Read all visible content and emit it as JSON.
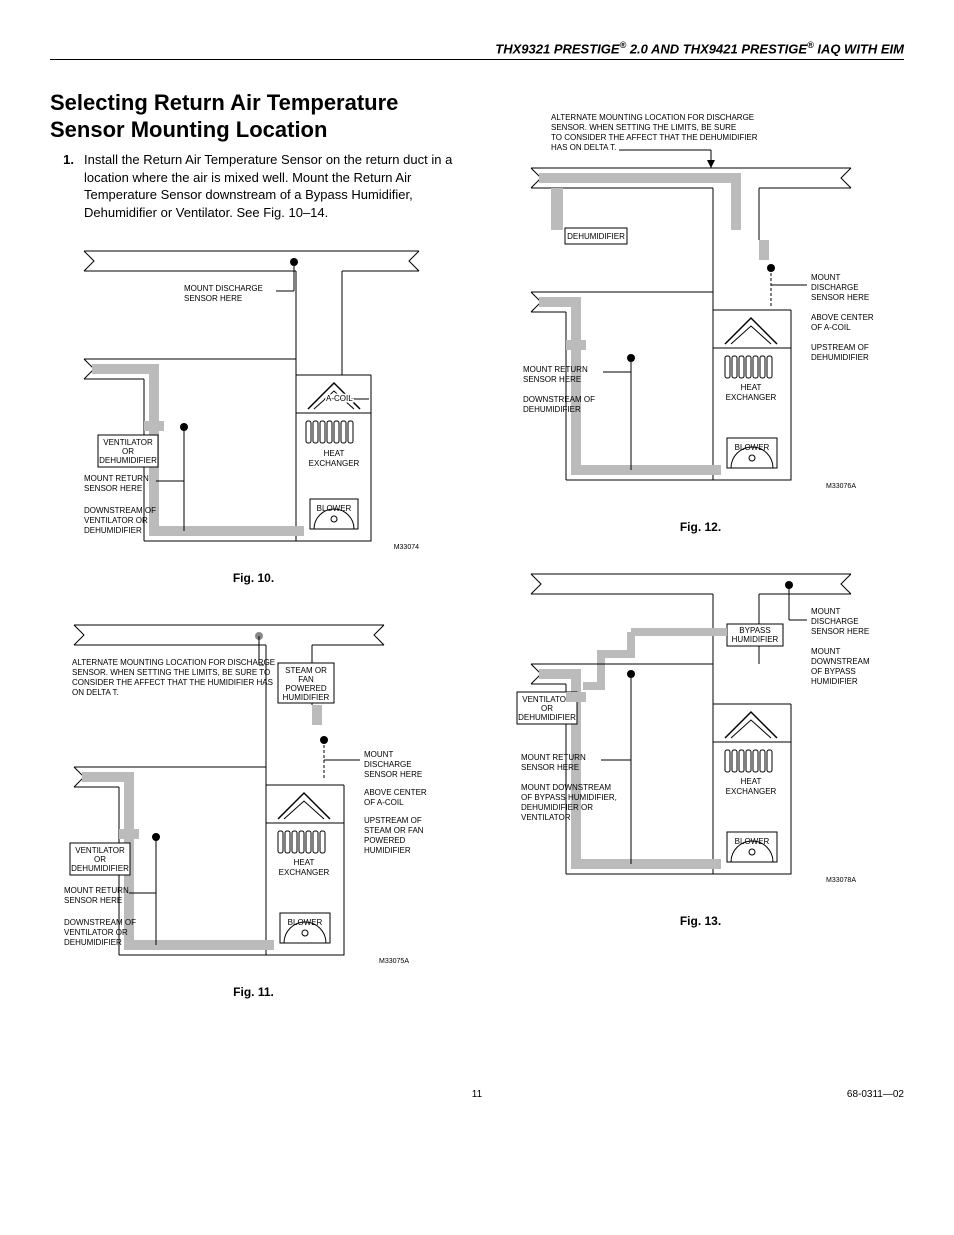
{
  "header": {
    "left": "THX9321 PRESTIGE",
    "reg": "®",
    "mid": " 2.0 AND THX9421 PRESTIGE",
    "right": " IAQ WITH EIM"
  },
  "section_title": "Selecting Return Air Temperature Sensor Mounting Location",
  "list": {
    "num1": "1.",
    "txt1": "Install the Return Air Temperature Sensor on the return duct in a location where the air is mixed well. Mount the Return Air Temperature Sensor downstream of a Bypass Humidifier, Dehumidifier or Ventilator. See Fig. 10–14."
  },
  "fig10": {
    "caption": "Fig. 10.",
    "mount_discharge1": "MOUNT DISCHARGE",
    "mount_discharge2": "SENSOR HERE",
    "acoil": "A-COIL",
    "heat_ex1": "HEAT",
    "heat_ex2": "EXCHANGER",
    "blower": "BLOWER",
    "vent1": "VENTILATOR",
    "vent2": "OR",
    "vent3": "DEHUMIDIFIER",
    "mr1": "MOUNT RETURN",
    "mr2": "SENSOR HERE",
    "ds1": "DOWNSTREAM OF",
    "ds2": "VENTILATOR OR",
    "ds3": "DEHUMIDIFIER",
    "code": "M33074"
  },
  "fig11": {
    "caption": "Fig. 11.",
    "alt1": "ALTERNATE  MOUNTING LOCATION FOR DISCHARGE",
    "alt2": "SENSOR. WHEN SETTING THE LIMITS, BE SURE TO",
    "alt3": "CONSIDER THE AFFECT THAT THE HUMIDIFIER HAS",
    "alt4": "ON DELTA T.",
    "steam1": "STEAM OR",
    "steam2": "FAN",
    "steam3": "POWERED",
    "steam4": "HUMIDIFIER",
    "md1": "MOUNT",
    "md2": "DISCHARGE",
    "md3": "SENSOR HERE",
    "ac1": "ABOVE CENTER",
    "ac2": "OF A-COIL",
    "up1": "UPSTREAM OF",
    "up2": "STEAM OR FAN",
    "up3": "POWERED",
    "up4": "HUMIDIFIER",
    "heat_ex1": "HEAT",
    "heat_ex2": "EXCHANGER",
    "blower": "BLOWER",
    "vent1": "VENTILATOR",
    "vent2": "OR",
    "vent3": "DEHUMIDIFIER",
    "mr1": "MOUNT RETURN",
    "mr2": "SENSOR HERE",
    "ds1": "DOWNSTREAM OF",
    "ds2": "VENTILATOR OR",
    "ds3": "DEHUMIDIFIER",
    "code": "M33075A"
  },
  "fig12": {
    "caption": "Fig. 12.",
    "alt1": "ALTERNATE MOUNTING LOCATION FOR DISCHARGE",
    "alt2": "SENSOR. WHEN SETTING THE LIMITS, BE SURE",
    "alt3": "TO CONSIDER THE AFFECT THAT THE DEHUMIDIFIER",
    "alt4": "HAS ON DELTA T.",
    "dehum": "DEHUMIDIFIER",
    "md1": "MOUNT",
    "md2": "DISCHARGE",
    "md3": "SENSOR HERE",
    "ac1": "ABOVE CENTER",
    "ac2": "OF A-COIL",
    "up1": "UPSTREAM OF",
    "up2": "DEHUMIDIFIER",
    "heat_ex1": "HEAT",
    "heat_ex2": "EXCHANGER",
    "blower": "BLOWER",
    "mr1": "MOUNT RETURN",
    "mr2": "SENSOR HERE",
    "ds1": "DOWNSTREAM OF",
    "ds2": "DEHUMIDIFIER",
    "code": "M33076A"
  },
  "fig13": {
    "caption": "Fig. 13.",
    "bypass1": "BYPASS",
    "bypass2": "HUMIDIFIER",
    "md1": "MOUNT",
    "md2": "DISCHARGE",
    "md3": "SENSOR HERE",
    "mdn1": "MOUNT",
    "mdn2": "DOWNSTREAM",
    "mdn3": "OF BYPASS",
    "mdn4": "HUMIDIFIER",
    "vent1": "VENTILATOR",
    "vent2": "OR",
    "vent3": "DEHUMIDIFIER",
    "heat_ex1": "HEAT",
    "heat_ex2": "EXCHANGER",
    "blower": "BLOWER",
    "mr1": "MOUNT RETURN",
    "mr2": "SENSOR HERE",
    "ds1": "MOUNT DOWNSTREAM",
    "ds2": "OF BYPASS HUMIDIFIER,",
    "ds3": "DEHUMIDIFIER OR",
    "ds4": "VENTILATOR",
    "code": "M33078A"
  },
  "footer": {
    "page": "11",
    "doc": "68-0311—02"
  }
}
